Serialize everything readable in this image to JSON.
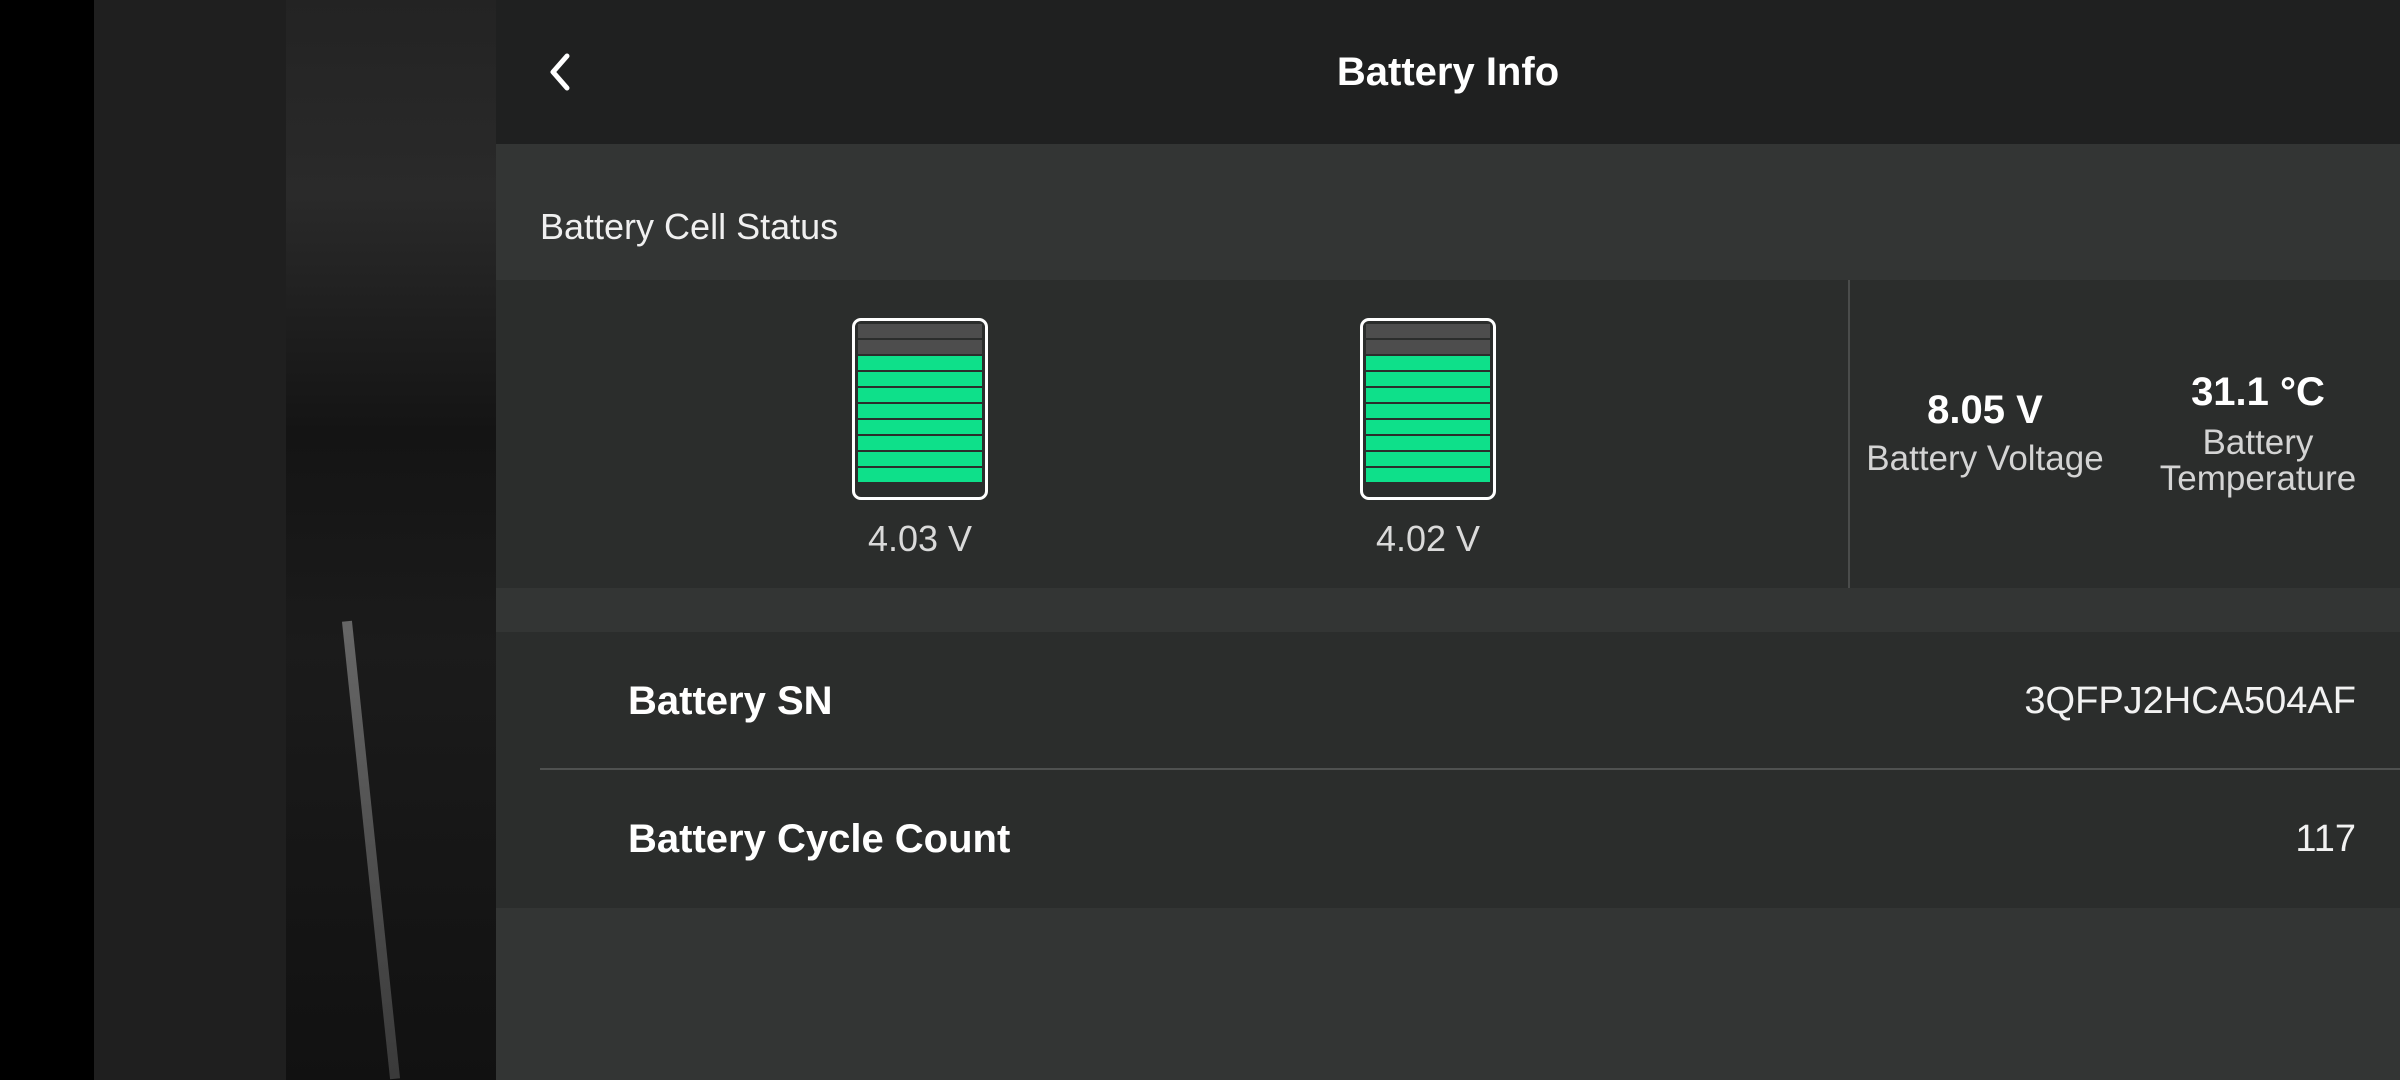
{
  "header": {
    "title": "Battery Info",
    "back_icon": "chevron-left-icon"
  },
  "cell_status": {
    "section_label": "Battery Cell Status",
    "cells": [
      {
        "voltage": "4.03 V",
        "level": 0.8
      },
      {
        "voltage": "4.02 V",
        "level": 0.8
      }
    ],
    "voltage": {
      "value": "8.05 V",
      "label": "Battery Voltage"
    },
    "temperature": {
      "value": "31.1 °C",
      "label_line1": "Battery",
      "label_line2": "Temperature"
    }
  },
  "info": {
    "sn_label": "Battery SN",
    "sn_value": "3QFPJ2HCA504AF",
    "cycle_label": "Battery Cycle Count",
    "cycle_value": "117"
  },
  "colors": {
    "cell_fill": "#0ee08a",
    "cell_empty": "#4d4d4d",
    "panel": "#333534",
    "header": "#1f2020"
  }
}
